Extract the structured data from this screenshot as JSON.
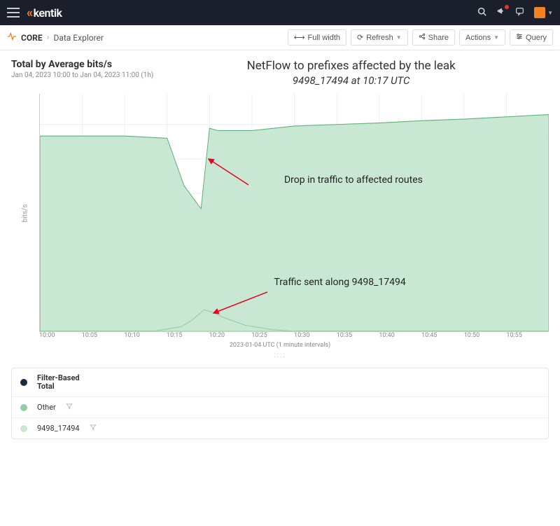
{
  "brand": "kentik",
  "breadcrumb": {
    "core": "CORE",
    "page": "Data Explorer"
  },
  "toolbar": {
    "fullwidth": "Full width",
    "refresh": "Refresh",
    "share": "Share",
    "actions": "Actions",
    "query": "Query"
  },
  "header": {
    "title": "Total by Average bits/s",
    "subtitle": "Jan 04, 2023 10:00 to Jan 04, 2023 11:00 (1h)"
  },
  "annotation": {
    "title": "NetFlow to prefixes affected by the leak",
    "subtitle": "9498_17494 at 10:17 UTC",
    "drop": "Drop in traffic to affected routes",
    "sent": "Traffic sent along 9498_17494"
  },
  "axes": {
    "ylabel": "bits/s",
    "xlabel": "2023-01-04 UTC (1 minute intervals)",
    "xticks": [
      "10:00",
      "10:05",
      "10:10",
      "10:15",
      "10:20",
      "10:25",
      "10:30",
      "10:35",
      "10:40",
      "10:45",
      "10:50",
      "10:55"
    ]
  },
  "legend": {
    "header_l1": "Filter-Based",
    "header_l2": "Total",
    "rows": [
      {
        "label": "Other",
        "color": "#8fcfa6"
      },
      {
        "label": "9498_17494",
        "color": "#c8e8d3"
      }
    ],
    "header_color": "#1a2a44"
  },
  "chart_data": {
    "type": "area",
    "x": [
      0,
      5,
      10,
      15,
      17,
      19,
      20,
      21,
      25,
      30,
      35,
      40,
      45,
      50,
      55,
      60
    ],
    "series": [
      {
        "name": "Total",
        "values": [
          73,
          73,
          73,
          72,
          50,
          40,
          78,
          77,
          77,
          80,
          81,
          82,
          83,
          84,
          85,
          86
        ]
      },
      {
        "name": "9498_17494",
        "values": [
          0,
          0,
          0,
          0,
          2,
          6,
          10,
          8,
          4,
          1,
          0,
          0,
          0,
          0,
          0,
          0
        ]
      }
    ],
    "xlabel": "2023-01-04 UTC (1 minute intervals)",
    "ylabel": "bits/s",
    "xlim": [
      0,
      60
    ],
    "ylim": [
      0,
      100
    ]
  }
}
